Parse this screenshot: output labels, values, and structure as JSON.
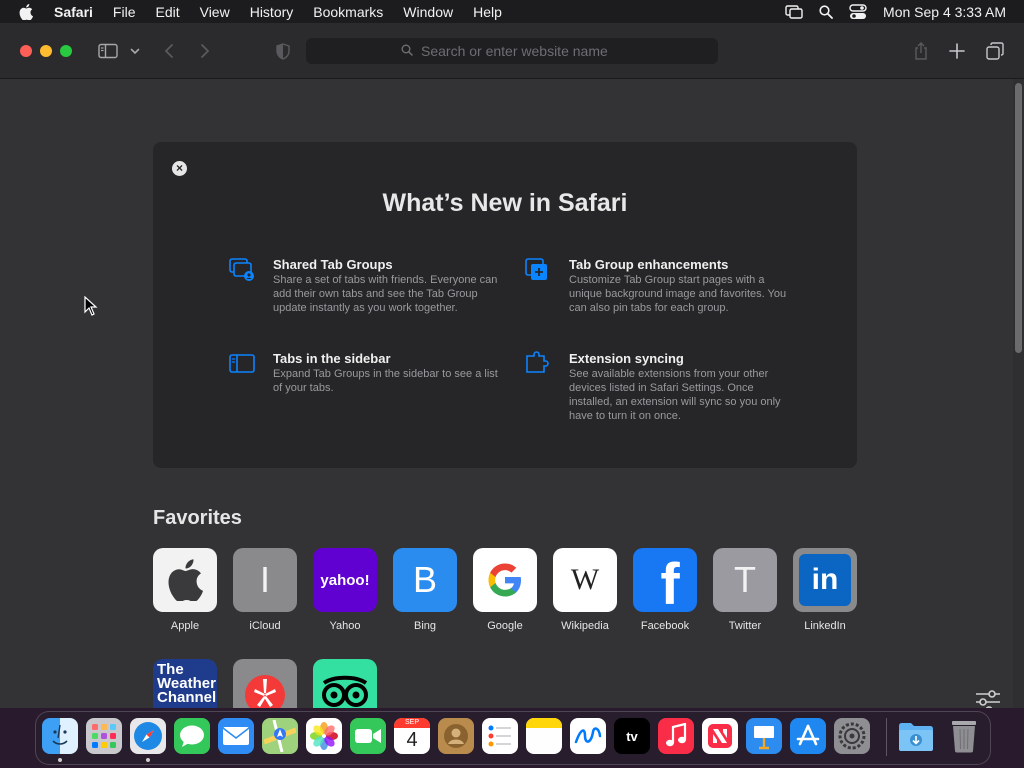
{
  "menubar": {
    "app_name": "Safari",
    "items": [
      "File",
      "Edit",
      "View",
      "History",
      "Bookmarks",
      "Window",
      "Help"
    ],
    "clock": "Mon Sep 4  3:33 AM"
  },
  "toolbar": {
    "address_placeholder": "Search or enter website name"
  },
  "whats_new": {
    "title": "What’s New in Safari",
    "features": [
      {
        "title": "Shared Tab Groups",
        "description": "Share a set of tabs with friends. Everyone can add their own tabs and see the Tab Group update instantly as you work together.",
        "icon": "shared-tab-groups-icon"
      },
      {
        "title": "Tab Group enhancements",
        "description": "Customize Tab Group start pages with a unique background image and favorites. You can also pin tabs for each group.",
        "icon": "tab-group-enhancements-icon"
      },
      {
        "title": "Tabs in the sidebar",
        "description": "Expand Tab Groups in the sidebar to see a list of your tabs.",
        "icon": "sidebar-icon"
      },
      {
        "title": "Extension syncing",
        "description": "See available extensions from your other devices listed in Safari Settings. Once installed, an extension will sync so you only have to turn it on once.",
        "icon": "extension-icon"
      }
    ]
  },
  "favorites": {
    "title": "Favorites",
    "items": [
      {
        "label": "Apple",
        "glyph": "",
        "color": "#f2f2f2"
      },
      {
        "label": "iCloud",
        "glyph": "I",
        "color": "#8a8a8c"
      },
      {
        "label": "Yahoo",
        "glyph": "yahoo!",
        "color": "#6001d2"
      },
      {
        "label": "Bing",
        "glyph": "B",
        "color": "#2b8cf0"
      },
      {
        "label": "Google",
        "glyph": "G",
        "color": "#ffffff"
      },
      {
        "label": "Wikipedia",
        "glyph": "W",
        "color": "#ffffff"
      },
      {
        "label": "Facebook",
        "glyph": "f",
        "color": "#1877f2"
      },
      {
        "label": "Twitter",
        "glyph": "T",
        "color": "#9a9aa0"
      },
      {
        "label": "LinkedIn",
        "glyph": "in",
        "color": "#0a66c2"
      }
    ],
    "row2": [
      {
        "label": "",
        "glyph": "The Weather Channel",
        "color": "#1f3c8c"
      },
      {
        "label": "",
        "glyph": "yelp-icon",
        "color": "#8a8a8c"
      },
      {
        "label": "",
        "glyph": "tripadvisor-icon",
        "color": "#34e0a1"
      }
    ]
  },
  "dock": {
    "apps": [
      "Finder",
      "Launchpad",
      "Safari",
      "Messages",
      "Mail",
      "Maps",
      "Photos",
      "FaceTime",
      "Calendar",
      "Contacts",
      "Reminders",
      "Notes",
      "Freeform",
      "TV",
      "Music",
      "News",
      "Keynote",
      "App Store",
      "System Settings",
      "Downloads",
      "Trash"
    ],
    "calendar_month": "SEP",
    "calendar_day": "4",
    "tv_label": "tv"
  },
  "colors": {
    "close": "#ff5f57",
    "minimize": "#febc2e",
    "zoom": "#28c840",
    "accent": "#0a84ff"
  }
}
